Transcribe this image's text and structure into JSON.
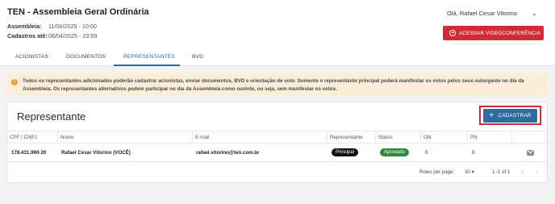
{
  "header": {
    "title": "TEN - Assembleia Geral Ordinária",
    "assembleia_label": "Assembleia:",
    "assembleia_value": "11/06/2025 - 10:00",
    "cadastros_label": "Cadastros até:",
    "cadastros_value": "08/04/2025 - 23:59",
    "greeting": "Olá, Rafael Cesar Vitorino",
    "video_button": "ACESSAR VIDEOCONFERÊNCIA"
  },
  "tabs": [
    {
      "label": "ACIONISTAS",
      "active": false
    },
    {
      "label": "DOCUMENTOS",
      "active": false
    },
    {
      "label": "REPRESENTANTES",
      "active": true
    },
    {
      "label": "BVD",
      "active": false
    }
  ],
  "notice": {
    "icon": "info-icon",
    "text": "Todos os representantes adicionados poderão cadastrar acionistas, enviar documentos, BVD e orientação de voto. Somente o representante principal poderá manifestar os votos pelos seus outorgante no dia da Assembleia. Os representantes alternativos podem participar no dia da Assembleia como ouvinte, ou seja, sem manifestar os votos."
  },
  "card": {
    "title": "Representante",
    "cadastrar_button": "CADASTRAR"
  },
  "table": {
    "columns": [
      "CPF / CNPJ",
      "Nome",
      "E-mail",
      "Representante",
      "Status",
      "ON",
      "PN"
    ],
    "rows": [
      {
        "cpf": "178.431.990-20",
        "nome": "Rafael Cesar Vitorino (VOCÊ)",
        "email": "rafael.vitorino@ten.com.br",
        "representante": "Principal",
        "status": "Aprovado",
        "on": "0",
        "pn": "0"
      }
    ]
  },
  "pagination": {
    "rows_label": "Rows per page:",
    "rows_value": "30",
    "range": "1–1 of 1"
  },
  "colors": {
    "accent_blue": "#2e6b9e",
    "danger_red": "#d12c35",
    "notice_bg": "#fbeed9",
    "approved_green": "#2f8a3e"
  }
}
